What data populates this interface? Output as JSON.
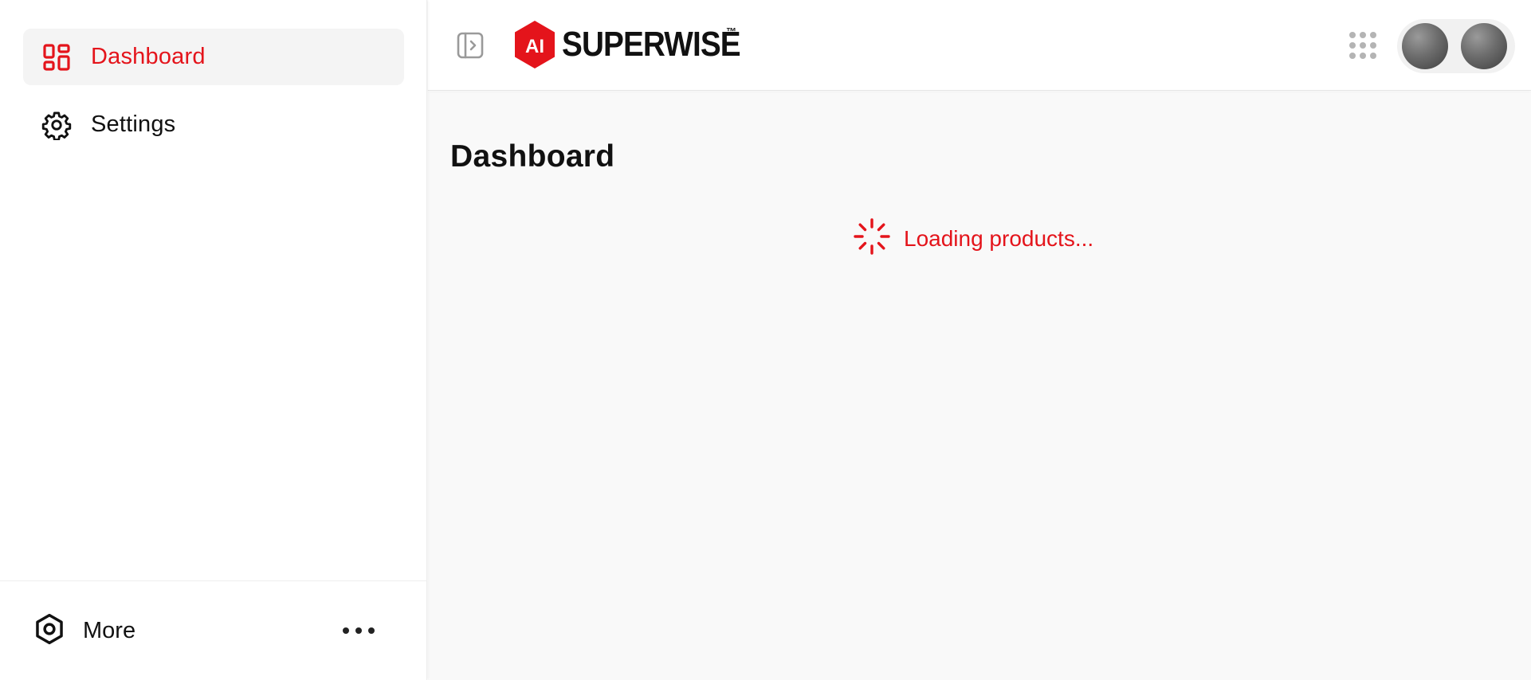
{
  "sidebar": {
    "items": [
      {
        "label": "Dashboard",
        "icon": "dashboard-icon",
        "active": true
      },
      {
        "label": "Settings",
        "icon": "gear-icon",
        "active": false
      }
    ],
    "footer": {
      "more_label": "More",
      "more_icon": "hexagon-settings-icon",
      "menu_icon": "ellipsis-icon"
    }
  },
  "header": {
    "logo": {
      "mark": "AI",
      "word": "SUPERWISE",
      "tm": "™"
    },
    "collapse_icon": "sidebar-toggle-icon",
    "apps_icon": "apps-grid-icon",
    "avatars": 2
  },
  "main": {
    "title": "Dashboard",
    "loading_text": "Loading products..."
  },
  "colors": {
    "accent": "#e4141b",
    "active_bg": "#f4f4f4",
    "main_bg": "#f9f9f9",
    "icon_grey": "#b4b4b4"
  }
}
